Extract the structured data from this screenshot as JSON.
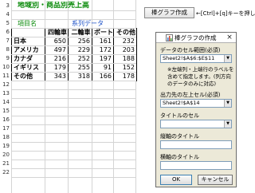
{
  "sheet": {
    "title": "地域別・商品別売上高",
    "row_numbers": [
      "3",
      "4",
      "5",
      "6",
      "7",
      "8",
      "9",
      "10",
      "11",
      "12",
      "13",
      "14",
      "15",
      "16",
      "17",
      "18",
      "19",
      "20",
      "21",
      "22"
    ],
    "header_label": "項目名",
    "series_label": "系列データ",
    "columns": [
      "四輪車",
      "二輪車",
      "ボート",
      "その他"
    ],
    "rows": [
      {
        "label": "日本",
        "values": [
          "650",
          "256",
          "161",
          "232"
        ]
      },
      {
        "label": "アメリカ",
        "values": [
          "497",
          "229",
          "172",
          "203"
        ]
      },
      {
        "label": "カナダ",
        "values": [
          "216",
          "252",
          "197",
          "188"
        ]
      },
      {
        "label": "イギリス",
        "values": [
          "179",
          "255",
          "91",
          "152"
        ]
      },
      {
        "label": "その他",
        "values": [
          "343",
          "318",
          "166",
          "178"
        ]
      }
    ]
  },
  "toolbar": {
    "chart_button_label": "棒グラフ作成",
    "hint": "←[Ctrl]+[q]キーを押し"
  },
  "dialog": {
    "title": "棒グラフの作成",
    "close_glyph": "×",
    "data_range_label": "データのセル範囲(必須)",
    "data_range_value": "Sheet2!$A$6:$E$11",
    "note": "※左端列・上端行のラベルを含めて指定します。(列方向のデータのみに対応)",
    "output_label": "出力先の左上セル(必須)",
    "output_value": "Sheet2!$A$14",
    "title_cell_label": "タイトルのセル",
    "title_cell_value": "",
    "vertical_title_label": "縦軸のタイトル",
    "vertical_title_value": "",
    "horizontal_title_label": "横軸のタイトル",
    "horizontal_title_value": "",
    "ok_label": "OK",
    "cancel_label": "キャンセル"
  },
  "icons": {
    "dropdown": "▼",
    "dialog": "chart-icon"
  },
  "colors": {
    "title_green": "#0a8a0a",
    "series_blue": "#1e52c8",
    "dialog_bg": "#ece9d8"
  }
}
